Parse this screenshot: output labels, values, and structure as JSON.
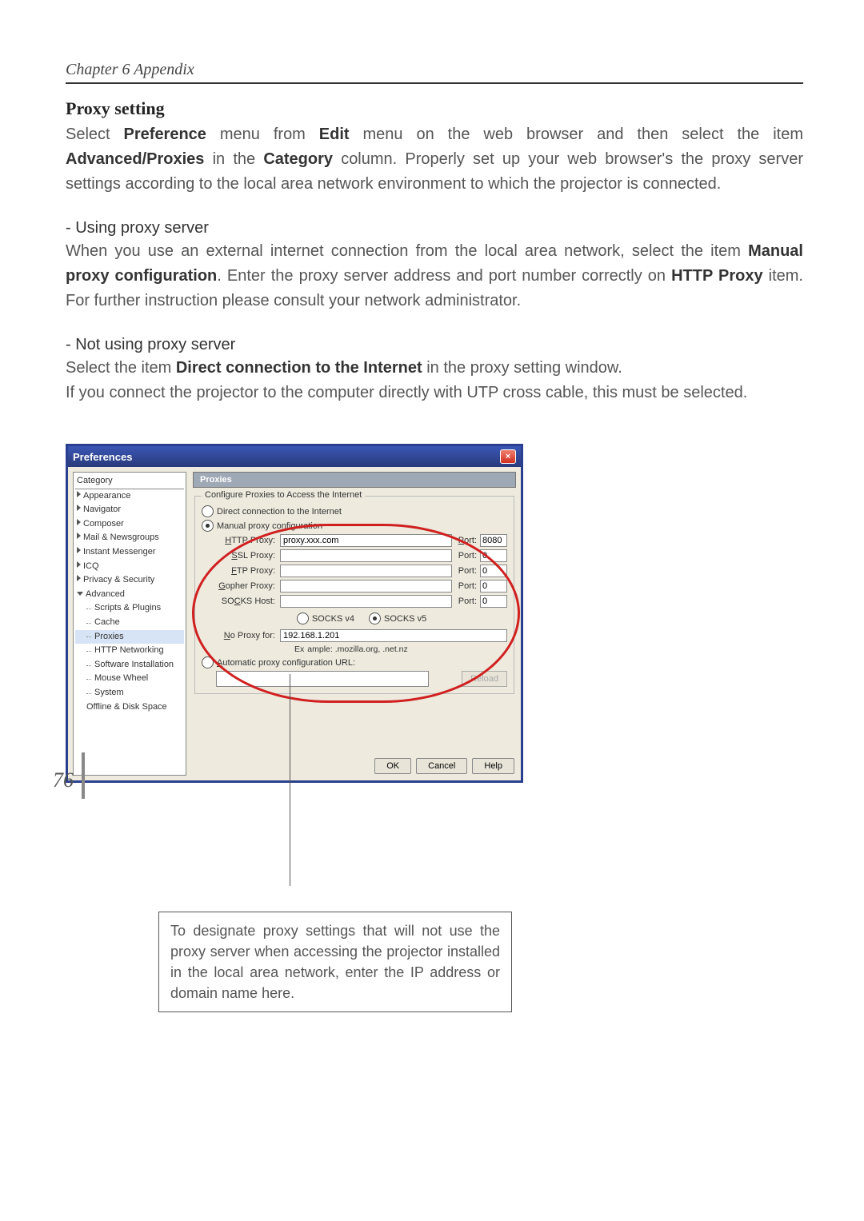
{
  "chapter": "Chapter 6 Appendix",
  "section_title": "Proxy setting",
  "para1_a": "Select ",
  "para1_b": "Preference",
  "para1_c": " menu from ",
  "para1_d": "Edit",
  "para1_e": " menu on the web browser and then select the item ",
  "para1_f": "Advanced/Proxies",
  "para1_g": " in the ",
  "para1_h": "Category",
  "para1_i": " column. Properly set up your web browser's the proxy server settings according to the local area network environment to which the projector is connected.",
  "sub1_title": "- Using proxy server",
  "sub1_a": "When you use an external internet connection from the local area network, select the item ",
  "sub1_b": "Manual proxy configuration",
  "sub1_c": ". Enter the proxy server address and port number correctly on ",
  "sub1_d": "HTTP Proxy",
  "sub1_e": " item. For further instruction please consult your network administrator.",
  "sub2_title": "- Not using proxy server",
  "sub2_a": "Select the item ",
  "sub2_b": "Direct connection to the Internet",
  "sub2_c": " in the proxy setting window.",
  "sub2_d": "If you connect the projector to the computer directly with UTP cross cable, this must be selected.",
  "window": {
    "title": "Preferences",
    "close": "×",
    "tree_header": "Category",
    "tree": {
      "appearance": "Appearance",
      "navigator": "Navigator",
      "composer": "Composer",
      "mail": "Mail & Newsgroups",
      "im": "Instant Messenger",
      "icq": "ICQ",
      "privacy": "Privacy & Security",
      "advanced": "Advanced",
      "scripts": "Scripts & Plugins",
      "cache": "Cache",
      "proxies": "Proxies",
      "httpnet": "HTTP Networking",
      "softinst": "Software Installation",
      "mouse": "Mouse Wheel",
      "system": "System",
      "offline": "Offline & Disk Space"
    },
    "panel_title": "Proxies",
    "fieldset_legend": "Configure Proxies to Access the Internet",
    "r_direct": "Direct connection to the Internet",
    "r_manual": "Manual proxy configuration",
    "http_label": "HTTP Proxy:",
    "ssl_label": "SSL Proxy:",
    "ftp_label": "FTP Proxy:",
    "gopher_label": "Gopher Proxy:",
    "socks_label": "SOCKS Host:",
    "port_label": "Port:",
    "http_value": "proxy.xxx.com",
    "http_port": "8080",
    "ssl_port": "0",
    "ftp_port": "0",
    "gopher_port": "0",
    "socks_port": "0",
    "socksv4": "SOCKS v4",
    "socksv5": "SOCKS v5",
    "noproxy_label": "No Proxy for:",
    "noproxy_value": "192.168.1.201",
    "example_pre": "Ex",
    "example_post": "ample: .mozilla.org, .net.nz",
    "r_auto": "Automatic proxy configuration URL:",
    "reload": "Reload",
    "ok": "OK",
    "cancel": "Cancel",
    "help": "Help"
  },
  "callout": "To designate proxy settings that will not use the proxy server when accessing the projector installed in the local area network, enter the IP address or domain name here.",
  "page_number": "76"
}
